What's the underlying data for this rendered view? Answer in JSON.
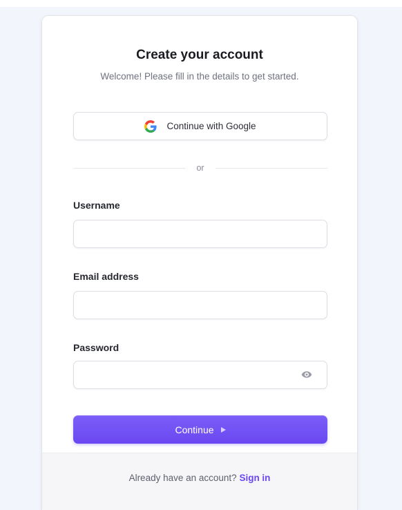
{
  "form": {
    "title": "Create your account",
    "subtitle": "Welcome! Please fill in the details to get started.",
    "social_button_label": "Continue with Google",
    "social_button_icon": "google-icon",
    "divider_text": "or",
    "fields": [
      {
        "label": "Username",
        "value": "",
        "placeholder": ""
      },
      {
        "label": "Email address",
        "value": "",
        "placeholder": ""
      },
      {
        "label": "Password",
        "value": "",
        "placeholder": "",
        "toggle_icon": "eye-icon"
      }
    ],
    "submit_label": "Continue",
    "submit_icon": "play-icon"
  },
  "footer": {
    "prompt_text": "Already have an account?",
    "link_text": "Sign in"
  },
  "colors": {
    "accent": "#6c47f2",
    "page_background": "#f3f5fd",
    "card_background": "#ffffff",
    "footer_background": "#f6f6f8",
    "link": "#6a47f1"
  }
}
